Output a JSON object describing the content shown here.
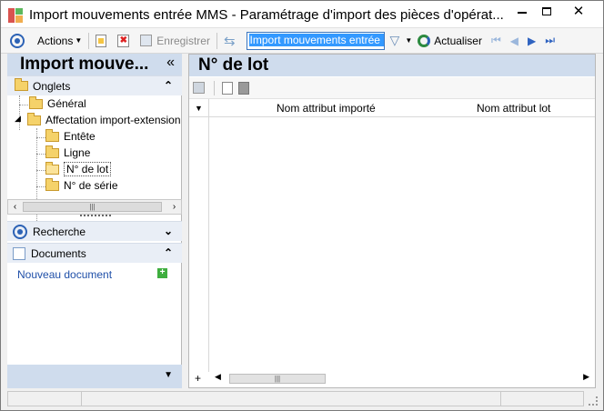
{
  "window": {
    "title": "Import mouvements entrée MMS -  Paramétrage d'import des pièces d'opérat..."
  },
  "toolbar": {
    "actions_label": "Actions",
    "save_label": "Enregistrer",
    "search_value": "Import mouvements entrée MMS",
    "refresh_label": "Actualiser"
  },
  "left": {
    "title": "Import mouve...",
    "tabs_section": "Onglets",
    "tree": [
      {
        "label": "Général",
        "level": 1
      },
      {
        "label": "Affectation import-extension",
        "level": 1
      },
      {
        "label": "Entête",
        "level": 2
      },
      {
        "label": "Ligne",
        "level": 2
      },
      {
        "label": "N° de lot",
        "level": 2,
        "selected": true
      },
      {
        "label": "N° de série",
        "level": 2
      }
    ],
    "search_section": "Recherche",
    "documents_section": "Documents",
    "new_document": "Nouveau document"
  },
  "main": {
    "title": "N° de lot",
    "columns": [
      "Nom attribut importé",
      "Nom attribut lot"
    ]
  },
  "colors": {
    "header_bg": "#cfdced",
    "accent": "#2c62b5"
  }
}
